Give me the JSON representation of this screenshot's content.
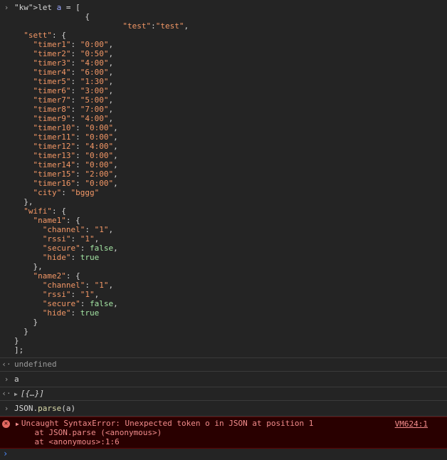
{
  "console": {
    "input_symbol": "›",
    "result_symbol": "‹·",
    "entries": [
      {
        "type": "input",
        "code_lines": [
          "let a = [",
          "               {",
          "                       \"test\":\"test\",",
          "  \"sett\": {",
          "    \"timer1\": \"0:00\",",
          "    \"timer2\": \"0:50\",",
          "    \"timer3\": \"4:00\",",
          "    \"timer4\": \"6:00\",",
          "    \"timer5\": \"1:30\",",
          "    \"timer6\": \"3:00\",",
          "    \"timer7\": \"5:00\",",
          "    \"timer8\": \"7:00\",",
          "    \"timer9\": \"4:00\",",
          "    \"timer10\": \"0:00\",",
          "    \"timer11\": \"0:00\",",
          "    \"timer12\": \"4:00\",",
          "    \"timer13\": \"0:00\",",
          "    \"timer14\": \"0:00\",",
          "    \"timer15\": \"2:00\",",
          "    \"timer16\": \"0:00\",",
          "    \"city\": \"bggg\"",
          "  },",
          "  \"wifi\": {",
          "    \"name1\": {",
          "      \"channel\": \"1\",",
          "      \"rssi\": \"1\",",
          "      \"secure\": false,",
          "      \"hide\": true",
          "    },",
          "    \"name2\": {",
          "      \"channel\": \"1\",",
          "      \"rssi\": \"1\",",
          "      \"secure\": false,",
          "      \"hide\": true",
          "    }",
          "  }",
          "}",
          "];"
        ]
      }
    ],
    "result_undefined": "undefined",
    "input_a": "a",
    "result_array": "[{…}]",
    "input_parse_prefix": "JSON.",
    "input_parse_fn": "parse",
    "input_parse_suffix": "(a)",
    "error": {
      "icon": "✕",
      "message": "Uncaught SyntaxError: Unexpected token o in JSON at position 1",
      "stack_1": "    at JSON.parse (<anonymous>)",
      "stack_2": "    at <anonymous>:1:6",
      "source_link": "VM624:1"
    }
  },
  "colors": {
    "background": "#242424",
    "string": "#f29766",
    "boolean": "#a3e4a3",
    "keyword": "#9aa7ff",
    "error_bg": "#290000",
    "error_text": "#f28b8b",
    "prompt": "#4d8cff"
  },
  "icons": {
    "input_prompt": "chevron-right-icon",
    "result_marker": "return-arrow-icon",
    "error": "error-circle-icon",
    "expand": "triangle-right-icon"
  }
}
